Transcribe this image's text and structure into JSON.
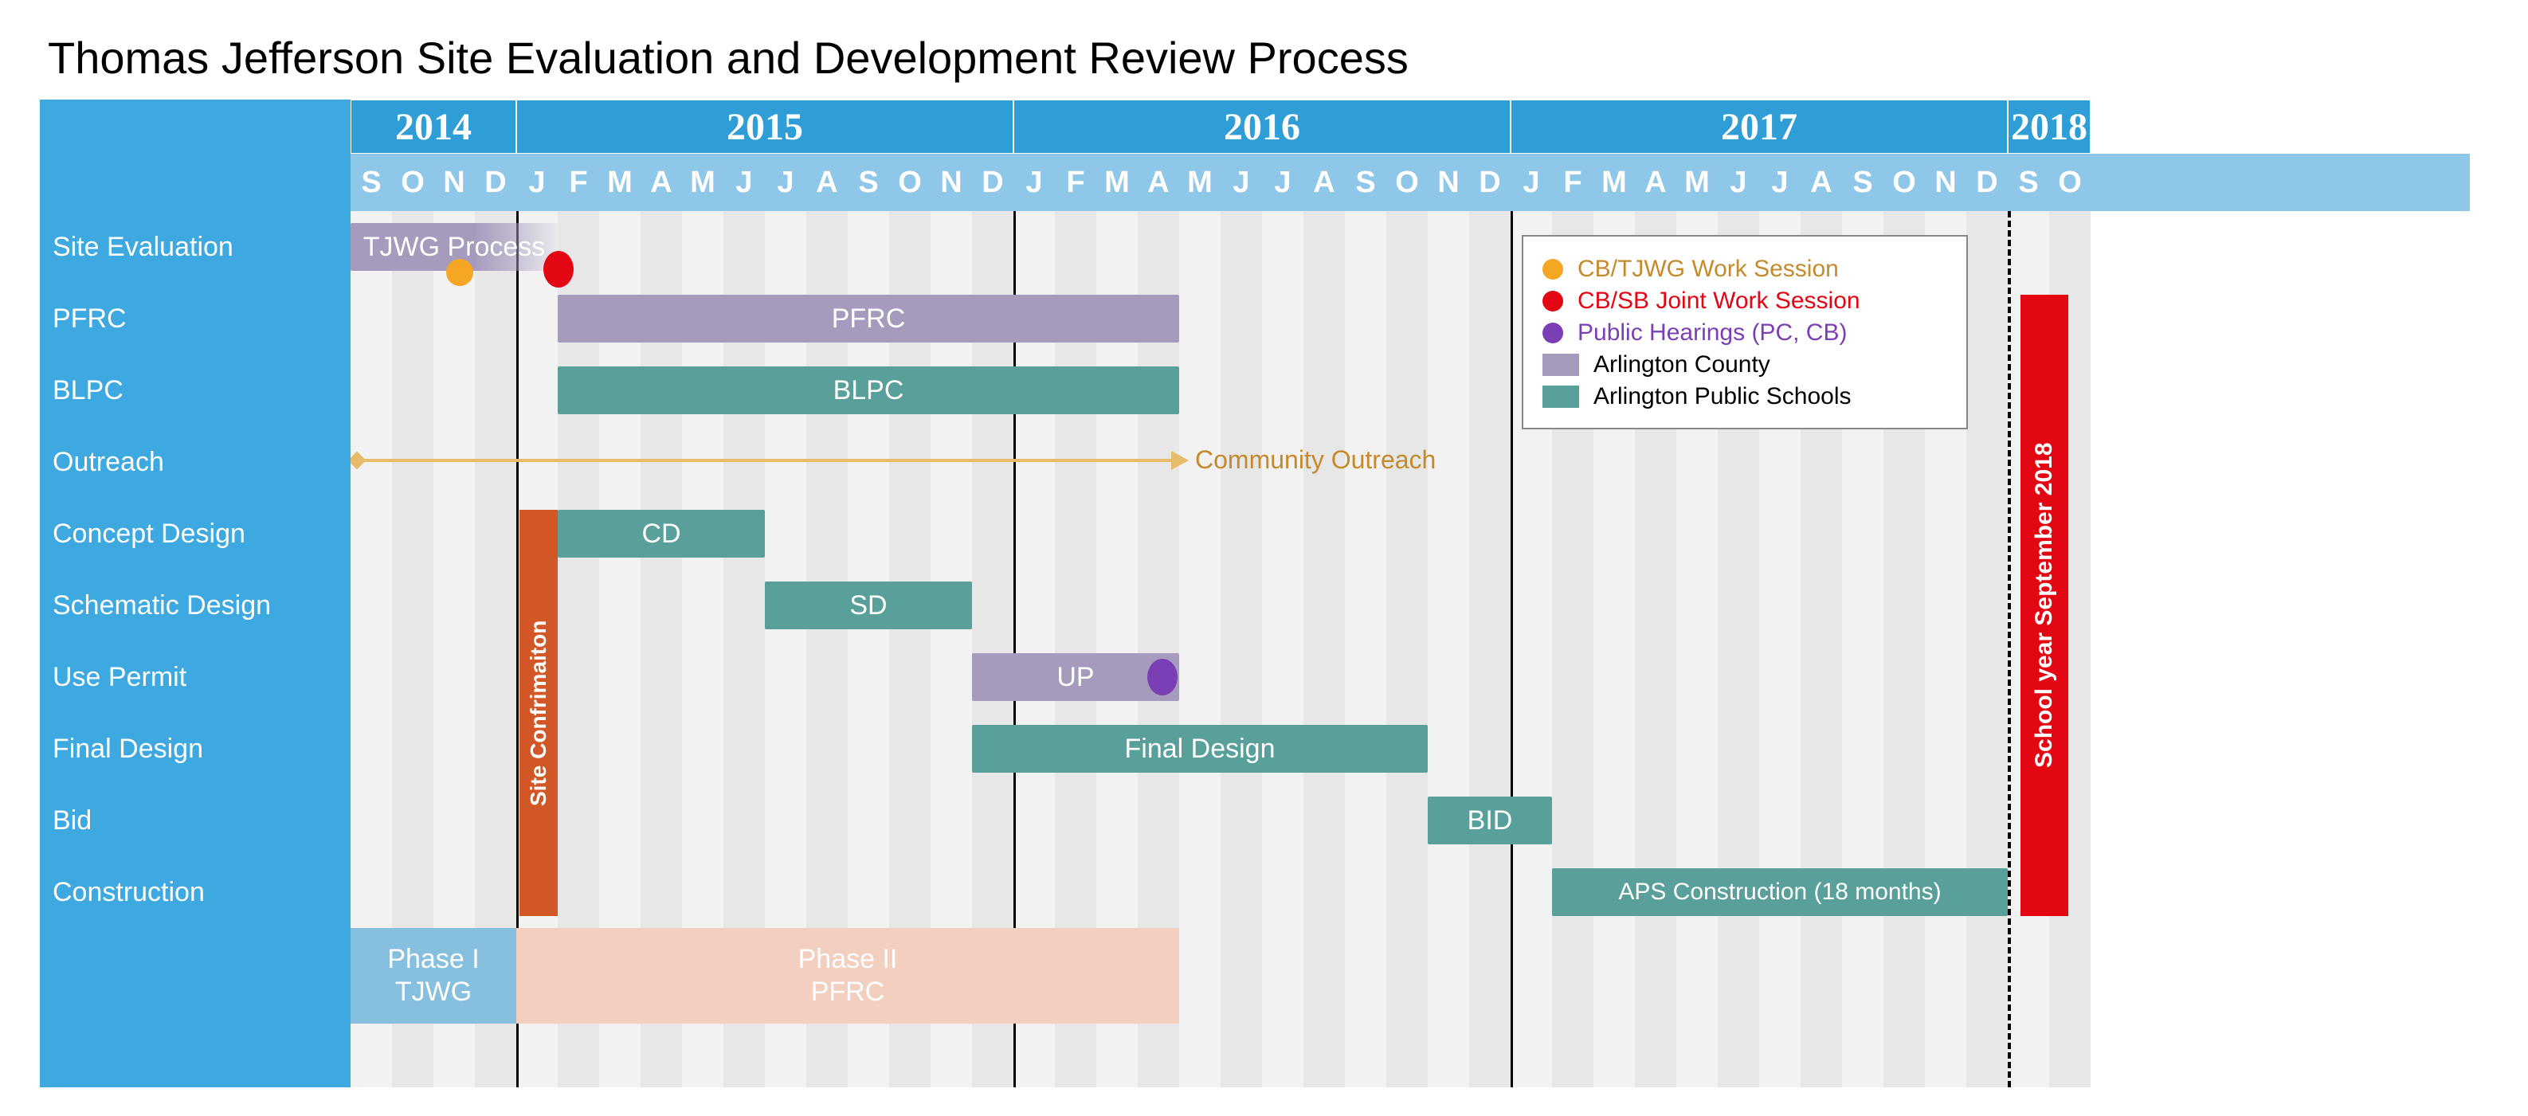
{
  "title": "Thomas Jefferson Site Evaluation and Development Review Process",
  "chart_data": {
    "type": "gantt",
    "xaxis": {
      "unit": "month",
      "start": "2014-09",
      "end": "2018-10",
      "months": [
        "S",
        "O",
        "N",
        "D",
        "J",
        "F",
        "M",
        "A",
        "M",
        "J",
        "J",
        "A",
        "S",
        "O",
        "N",
        "D",
        "J",
        "F",
        "M",
        "A",
        "M",
        "J",
        "J",
        "A",
        "S",
        "O",
        "N",
        "D",
        "J",
        "F",
        "M",
        "A",
        "M",
        "J",
        "J",
        "A",
        "S",
        "O",
        "N",
        "D",
        "S",
        "O"
      ],
      "years": [
        {
          "label": "2014",
          "span": 4
        },
        {
          "label": "2015",
          "span": 12
        },
        {
          "label": "2016",
          "span": 12
        },
        {
          "label": "2017",
          "span": 12
        },
        {
          "label": "2018",
          "span": 2,
          "note": "only Sep–Oct shown (gap implied)"
        }
      ],
      "year_dividers_at": [
        "2015-01",
        "2016-01",
        "2017-01"
      ],
      "dashed_marker_at": "2018-09"
    },
    "rows": [
      "Site Evaluation",
      "PFRC",
      "BLPC",
      "Outreach",
      "Concept Design",
      "Schematic Design",
      "Use Permit",
      "Final Design",
      "Bid",
      "Construction"
    ],
    "tasks": [
      {
        "row": "Site Evaluation",
        "label": "TJWG Process",
        "owner": "Arlington County",
        "start": "2014-09",
        "end": "2015-01",
        "style": "fade-right"
      },
      {
        "row": "PFRC",
        "label": "PFRC",
        "owner": "Arlington County",
        "start": "2015-02",
        "end": "2016-05"
      },
      {
        "row": "BLPC",
        "label": "BLPC",
        "owner": "Arlington Public Schools",
        "start": "2015-02",
        "end": "2016-05"
      },
      {
        "row": "Outreach",
        "label": "Community Outreach",
        "owner": "Outreach",
        "start": "2014-09",
        "end": "2016-05",
        "style": "arrow-line"
      },
      {
        "row": "Concept Design",
        "label": "CD",
        "owner": "Arlington Public Schools",
        "start": "2015-02",
        "end": "2015-07"
      },
      {
        "row": "Schematic Design",
        "label": "SD",
        "owner": "Arlington Public Schools",
        "start": "2015-07",
        "end": "2015-12"
      },
      {
        "row": "Use Permit",
        "label": "UP",
        "owner": "Arlington County",
        "start": "2015-12",
        "end": "2016-05"
      },
      {
        "row": "Final Design",
        "label": "Final Design",
        "owner": "Arlington Public Schools",
        "start": "2015-12",
        "end": "2016-11"
      },
      {
        "row": "Bid",
        "label": "BID",
        "owner": "Arlington Public Schools",
        "start": "2016-11",
        "end": "2017-02"
      },
      {
        "row": "Construction",
        "label": "APS Construction (18 months)",
        "owner": "Arlington Public Schools",
        "start": "2017-02",
        "end": "2018-09"
      }
    ],
    "milestones": [
      {
        "label": "CB/TJWG Work Session",
        "at": "2014-11",
        "color": "#f5a623",
        "row": "Site Evaluation"
      },
      {
        "label": "CB/SB Joint Work Session",
        "at": "2015-01",
        "color": "#e30613",
        "row": "Site Evaluation"
      },
      {
        "label": "Public Hearings (PC, CB)",
        "at": "2016-05",
        "color": "#7b3fb5",
        "row": "Use Permit"
      }
    ],
    "vertical_spans": [
      {
        "label": "Site Confrimaiton",
        "owner": "special",
        "start": "2015-01",
        "end": "2015-02",
        "from_row": "Concept Design",
        "to_row": "Construction",
        "color": "#d35726"
      },
      {
        "label": "School year September 2018",
        "owner": "special",
        "start": "2018-09",
        "end": "2018-10",
        "from_row": "PFRC",
        "to_row": "Construction",
        "color": "#e30613"
      }
    ],
    "phases": [
      {
        "label_line1": "Phase I",
        "label_line2": "TJWG",
        "start": "2014-09",
        "end": "2015-01",
        "color": "#87c0de"
      },
      {
        "label_line1": "Phase II",
        "label_line2": "PFRC",
        "start": "2015-01",
        "end": "2016-05",
        "color": "#f3cfc0"
      }
    ]
  },
  "legend": {
    "items": [
      {
        "kind": "dot",
        "color": "#f5a623",
        "text": "CB/TJWG Work Session",
        "text_color": "#c58a2c"
      },
      {
        "kind": "dot",
        "color": "#e30613",
        "text": "CB/SB Joint Work Session",
        "text_color": "#e30613"
      },
      {
        "kind": "dot",
        "color": "#7b3fb5",
        "text": "Public Hearings (PC, CB)",
        "text_color": "#7b3fb5"
      },
      {
        "kind": "box",
        "color": "#a79bbd",
        "text": "Arlington County",
        "text_color": "#000"
      },
      {
        "kind": "box",
        "color": "#59a09b",
        "text": "Arlington Public Schools",
        "text_color": "#000"
      }
    ]
  },
  "labels": {
    "site_conf": "Site Confrimaiton",
    "school_year": "School year September 2018",
    "outreach": "Community Outreach"
  }
}
